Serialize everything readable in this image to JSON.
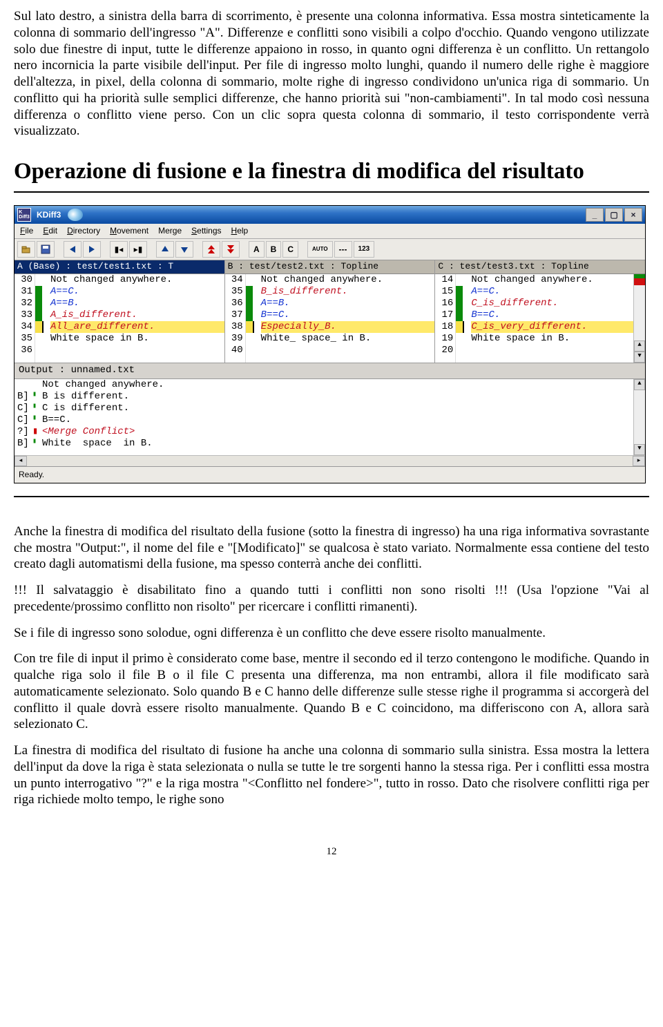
{
  "para1": "Sul lato destro, a sinistra della barra di scorrimento, è presente una colonna informativa. Essa mostra sinteticamente la colonna di sommario dell'ingresso \"A\". Differenze e conflitti sono visibili a colpo d'occhio. Quando vengono utilizzate solo due finestre di input, tutte le differenze appaiono in rosso, in quanto ogni differenza è un conflitto. Un rettangolo nero incornicia la parte visibile dell'input. Per file di ingresso molto lunghi, quando il numero delle righe è maggiore dell'altezza, in pixel, della colonna di sommario, molte righe di ingresso condividono un'unica riga di sommario. Un conflitto qui ha priorità sulle semplici differenze, che hanno priorità sui \"non-cambiamenti\". In tal modo così nessuna differenza o conflitto viene perso. Con un clic sopra questa colonna di sommario, il testo corrispondente verrà visualizzato.",
  "heading": "Operazione di fusione e la finestra di modifica del risultato",
  "para2": "Anche la finestra di modifica del risultato della fusione (sotto la finestra di ingresso) ha una riga informativa sovrastante che mostra \"Output:\", il nome del file e \"[Modificato]\" se qualcosa è stato variato. Normalmente essa contiene del testo creato dagli automatismi della fusione, ma spesso conterrà anche dei conflitti.",
  "para3": "!!! Il salvataggio è disabilitato fino a quando tutti i conflitti non sono risolti !!! (Usa l'opzione \"Vai al precedente/prossimo conflitto non risolto\" per ricercare i conflitti rimanenti).",
  "para4": "Se i file di ingresso sono solodue, ogni differenza è un conflitto che deve essere risolto manualmente.",
  "para5": "Con tre file di input il primo è considerato come base, mentre il secondo ed il terzo contengono le modifiche. Quando in qualche riga solo il file B o il file C presenta una differenza, ma non entrambi, allora il file modificato sarà automaticamente selezionato. Solo quando B e C hanno delle differenze sulle stesse righe il programma si accorgerà del conflitto il quale dovrà essere risolto manualmente. Quando B e C coincidono, ma differiscono con A, allora sarà selezionato C.",
  "para6": "La finestra di modifica del risultato di fusione ha anche una colonna di sommario sulla sinistra. Essa mostra la lettera dell'input da dove la riga è stata selezionata o nulla se tutte le tre sorgenti hanno la stessa riga. Per i conflitti essa mostra un punto interrogativo \"?\" e la riga mostra \"<Conflitto nel fondere>\", tutto in rosso. Dato che risolvere conflitti riga per riga richiede molto tempo, le righe sono",
  "pagenum": "12",
  "app": {
    "icon_text": "K\nDiff3",
    "title": "KDiff3",
    "menus": {
      "file": "File",
      "edit": "Edit",
      "dir": "Directory",
      "mov": "Movement",
      "merge": "Merge",
      "set": "Settings",
      "help": "Help"
    },
    "toolbar": {
      "A": "A",
      "B": "B",
      "C": "C",
      "auto": "AUTO",
      "un": "---",
      "num": "123"
    },
    "status": "Ready."
  },
  "paneA": {
    "head": "A (Base) : test/test1.txt : T",
    "nums": [
      "30",
      "31",
      "32",
      "33",
      "34",
      "35",
      "36"
    ],
    "rows": [
      {
        "t": "Not changed anywhere.",
        "cls": ""
      },
      {
        "t": "A==C.",
        "cls": "blue"
      },
      {
        "t": "A==B.",
        "cls": "blue"
      },
      {
        "t": "A_is_different.",
        "cls": "red"
      },
      {
        "t": "All_are_different.",
        "cls": "red hl"
      },
      {
        "t": "White space in B.",
        "cls": ""
      },
      {
        "t": "",
        "cls": ""
      }
    ]
  },
  "paneB": {
    "head": "B : test/test2.txt : Topline",
    "nums": [
      "34",
      "35",
      "36",
      "37",
      "38",
      "39",
      "40"
    ],
    "rows": [
      {
        "t": "Not changed anywhere.",
        "cls": ""
      },
      {
        "t": "B_is_different.",
        "cls": "red"
      },
      {
        "t": "A==B.",
        "cls": "blue"
      },
      {
        "t": "B==C.",
        "cls": "blue"
      },
      {
        "t": "Especially_B.",
        "cls": "red hl"
      },
      {
        "t": "White_ space_ in B.",
        "cls": ""
      },
      {
        "t": "",
        "cls": ""
      }
    ]
  },
  "paneC": {
    "head": "C : test/test3.txt : Topline",
    "nums": [
      "14",
      "15",
      "16",
      "17",
      "18",
      "19",
      "20"
    ],
    "rows": [
      {
        "t": "Not changed anywhere.",
        "cls": ""
      },
      {
        "t": "A==C.",
        "cls": "blue"
      },
      {
        "t": "C_is_different.",
        "cls": "red"
      },
      {
        "t": "B==C.",
        "cls": "blue"
      },
      {
        "t": "C_is_very_different.",
        "cls": "red hl"
      },
      {
        "t": "White space in B.",
        "cls": ""
      },
      {
        "t": "",
        "cls": ""
      }
    ]
  },
  "output": {
    "head": "Output : unnamed.txt",
    "tags": [
      "",
      "B",
      "C",
      "C",
      "?",
      "B"
    ],
    "rows": [
      {
        "t": "Not changed anywhere.",
        "cls": ""
      },
      {
        "t": "B is different.",
        "cls": ""
      },
      {
        "t": "C is different.",
        "cls": ""
      },
      {
        "t": "B==C.",
        "cls": ""
      },
      {
        "t": "<Merge Conflict>",
        "cls": "red"
      },
      {
        "t": "White  space  in B.",
        "cls": ""
      }
    ]
  }
}
